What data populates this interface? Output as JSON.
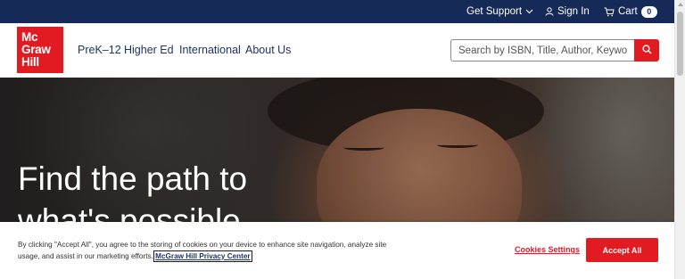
{
  "topbar": {
    "support_label": "Get Support",
    "signin_label": "Sign In",
    "cart_label": "Cart",
    "cart_count": "0"
  },
  "logo": {
    "line1": "Mc",
    "line2": "Graw",
    "line3": "Hill"
  },
  "nav": {
    "items": [
      {
        "label": "PreK–12"
      },
      {
        "label": "Higher Ed"
      },
      {
        "label": "International"
      },
      {
        "label": "About Us"
      }
    ]
  },
  "search": {
    "placeholder": "Search by ISBN, Title, Author, Keyword",
    "value": ""
  },
  "hero": {
    "title": "Find the path to what's possible"
  },
  "cookie_banner": {
    "text": "By clicking \"Accept All\", you agree to the storing of cookies on your device to enhance site navigation, analyze site usage, and assist in our marketing efforts.",
    "privacy_link": "McGraw Hill Privacy Center",
    "settings_label": "Cookies Settings",
    "accept_label": "Accept All"
  },
  "colors": {
    "topbar": "#152a56",
    "brand_red": "#e21b23",
    "nav_text": "#1d3467"
  },
  "icons": {
    "support": "chevron-down-icon",
    "signin": "user-icon",
    "cart": "cart-icon",
    "search": "search-icon"
  }
}
